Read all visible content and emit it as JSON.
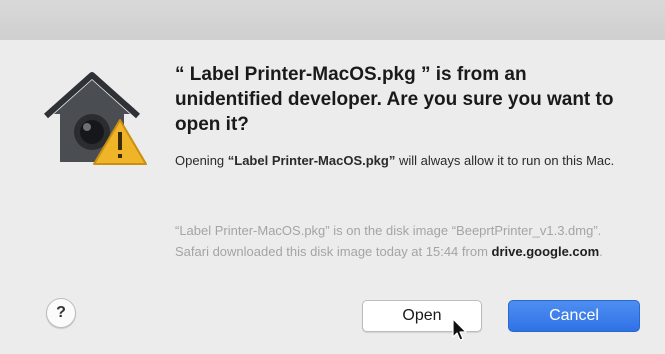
{
  "dialog": {
    "headline": "“ Label Printer-MacOS.pkg ” is from an unidentified developer. Are you sure you want to open it?",
    "subtext_prefix": "Opening ",
    "subtext_filename": "“Label Printer-MacOS.pkg”",
    "subtext_suffix": " will always allow it to run on this Mac.",
    "info_text": "“Label Printer-MacOS.pkg” is on the disk image “BeeprtPrinter_v1.3.dmg”. Safari downloaded this disk image today at 15:44 from ",
    "info_host": "drive.google.com",
    "info_end": "."
  },
  "buttons": {
    "help_label": "?",
    "open_label": "Open",
    "cancel_label": "Cancel"
  },
  "icons": {
    "app_icon": "gatekeeper-house-warning-icon",
    "cursor": "pointer-cursor-icon"
  },
  "colors": {
    "accent": "#2f72e6",
    "warning": "#f0b429"
  }
}
